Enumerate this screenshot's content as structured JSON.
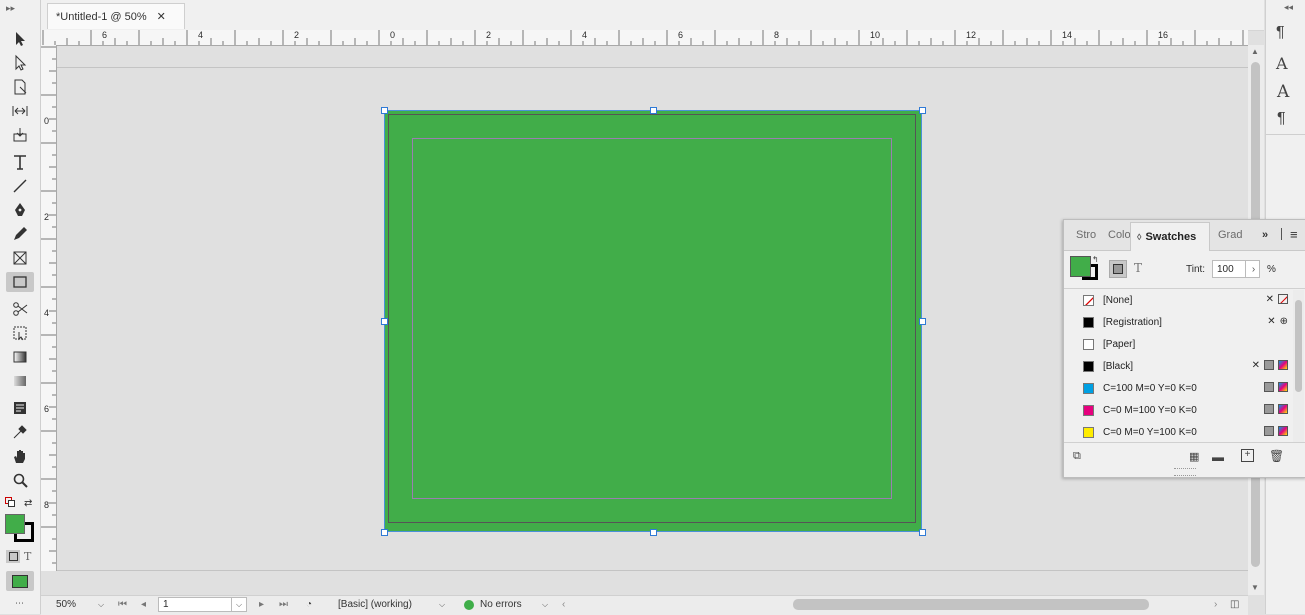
{
  "document": {
    "tab_title": "*Untitled-1 @ 50%",
    "close_glyph": "✕",
    "page_color": "#41ad49"
  },
  "rulers": {
    "horizontal_labels": [
      "6",
      "4",
      "2",
      "0",
      "2",
      "4",
      "6",
      "8",
      "10",
      "12",
      "14",
      "16"
    ],
    "vertical_labels": [
      "0",
      "2",
      "4",
      "6",
      "8"
    ]
  },
  "swatches_panel": {
    "tabs": [
      "Stro",
      "Colo",
      "Swatches",
      "Grad"
    ],
    "active_tab": "Swatches",
    "tint_label": "Tint:",
    "tint_value": "100",
    "tint_unit": "%",
    "fill_color": "#41ad49",
    "swatches": [
      {
        "name": "[None]",
        "color": "none"
      },
      {
        "name": "[Registration]",
        "color": "#000000"
      },
      {
        "name": "[Paper]",
        "color": "#ffffff"
      },
      {
        "name": "[Black]",
        "color": "#000000"
      },
      {
        "name": "C=100 M=0 Y=0 K=0",
        "color": "#00a0e3"
      },
      {
        "name": "C=0 M=100 Y=0 K=0",
        "color": "#e6007e"
      },
      {
        "name": "C=0 M=0 Y=100 K=0",
        "color": "#ffed00"
      }
    ]
  },
  "status": {
    "zoom": "50%",
    "page_number": "1",
    "profile": "[Basic] (working)",
    "errors": "No errors",
    "error_color": "#3fae49"
  },
  "toolbox": {
    "fill_color": "#41ad49",
    "stroke_color": "#000000"
  }
}
